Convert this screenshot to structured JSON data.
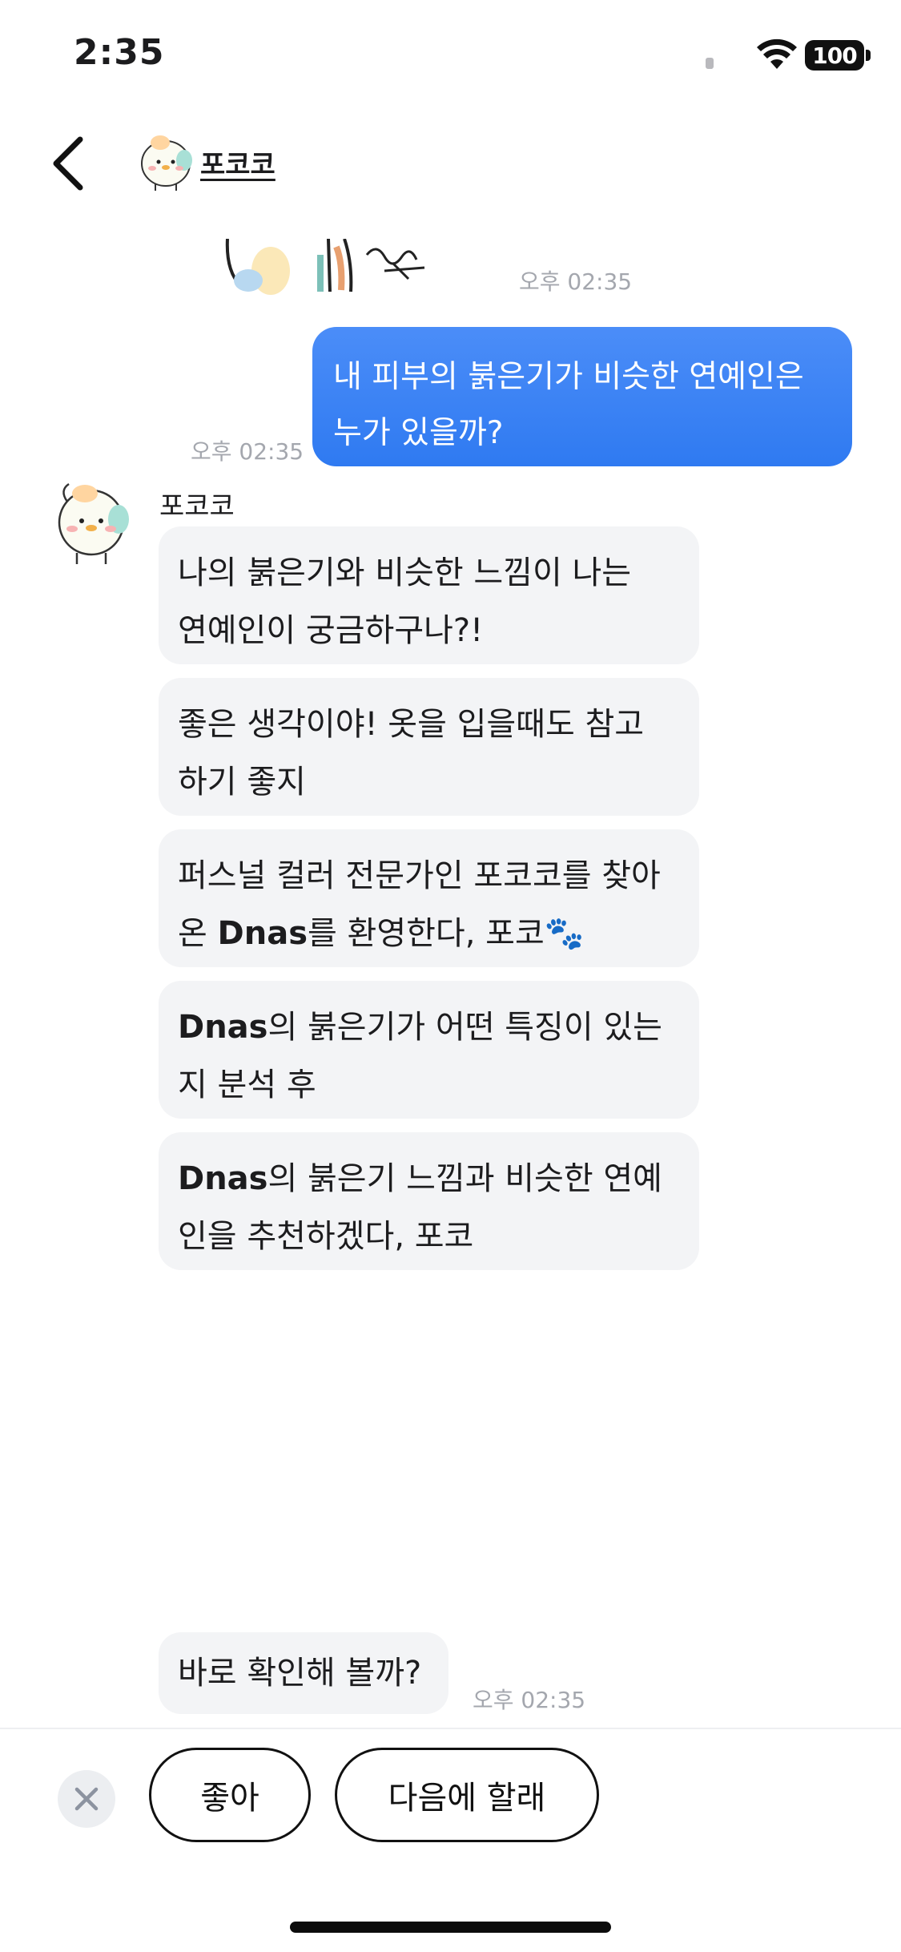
{
  "status_bar": {
    "time": "2:35",
    "battery": "100"
  },
  "header": {
    "title": "포코코",
    "avatar_icon": "mascot-avatar-icon",
    "back_icon": "chevron-left-icon"
  },
  "messages": {
    "image_timestamp": "오후 02:35",
    "user": {
      "lines": [
        "내 피부의 붉은기가 비슷한 연예인은",
        "누가 있을까?"
      ],
      "timestamp": "오후 02:35"
    },
    "bot": {
      "name": "포코코",
      "b1": {
        "lines": [
          "나의 붉은기와 비슷한 느낌이 나는",
          "연예인이 궁금하구나?!"
        ]
      },
      "b2": {
        "lines": [
          "좋은 생각이야! 옷을 입을때도 참고",
          "하기 좋지"
        ]
      },
      "b3": {
        "line1": "퍼스널 컬러 전문가인 포코코를 찾아",
        "line2_pre": "온 ",
        "line2_bold": "Dnas",
        "line2_post": "를 환영한다, 포코",
        "emoji": "🐾"
      },
      "b4": {
        "bold": "Dnas",
        "line1_post": "의 붉은기가 어떤 특징이 있는",
        "line2": "지 분석 후"
      },
      "b5": {
        "bold": "Dnas",
        "line1_post": "의 붉은기 느낌과 비슷한 연예",
        "line2": "인을 추천하겠다, 포코"
      }
    },
    "question": {
      "text": "바로 확인해 볼까?",
      "timestamp": "오후 02:35"
    }
  },
  "actions": {
    "close_icon": "close-icon",
    "yes_label": "좋아",
    "later_label": "다음에 할래"
  },
  "colors": {
    "user_bubble": "#3b82f6",
    "bot_bubble": "#f3f4f6",
    "timestamp": "#a4a7ae"
  }
}
